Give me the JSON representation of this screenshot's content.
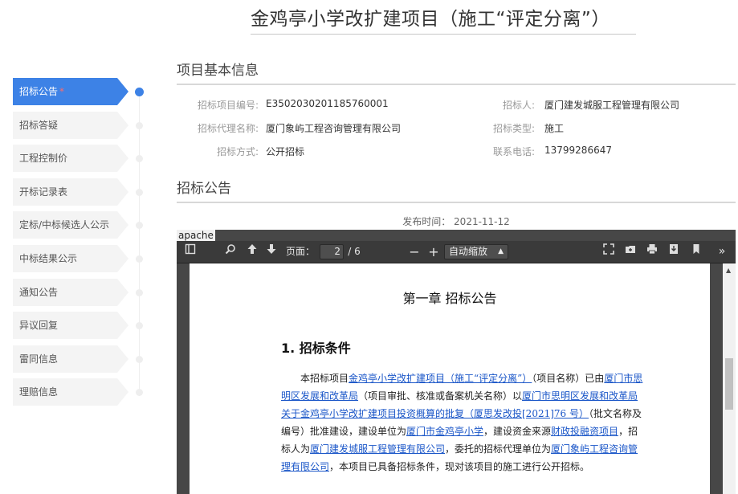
{
  "page": {
    "title": "金鸡亭小学改扩建项目（施工“评定分离”）"
  },
  "sidebar": {
    "items": [
      {
        "label": "招标公告",
        "active": true,
        "marker": "*"
      },
      {
        "label": "招标答疑"
      },
      {
        "label": "工程控制价"
      },
      {
        "label": "开标记录表"
      },
      {
        "label": "定标/中标候选人公示"
      },
      {
        "label": "中标结果公示"
      },
      {
        "label": "通知公告"
      },
      {
        "label": "异议回复"
      },
      {
        "label": "雷同信息"
      },
      {
        "label": "理赔信息"
      }
    ]
  },
  "info": {
    "section_title": "项目基本信息",
    "project_no_label": "招标项目编号:",
    "project_no": "E3502030201185760001",
    "tenderer_label": "招标人:",
    "tenderer": "厦门建发城服工程管理有限公司",
    "agent_label": "招标代理名称:",
    "agent": "厦门象屿工程咨询管理有限公司",
    "type_label": "招标类型:",
    "type": "施工",
    "method_label": "招标方式:",
    "method": "公开招标",
    "phone_label": "联系电话:",
    "phone": "13799286647"
  },
  "notice": {
    "section_title": "招标公告",
    "publish_label": "发布时间：",
    "publish_date": "2021-11-12"
  },
  "pdf": {
    "frame_label": "apache",
    "page_label": "页面：",
    "current_page": "2",
    "total_pages": "/ 6",
    "zoom_value": "自动缩放",
    "chapter": "第一章    招标公告",
    "heading": "1. 招标条件",
    "para": {
      "t1": "本招标项目",
      "u1": "金鸡亭小学改扩建项目（施工“评定分离”）",
      "t2": "（项目名称）已由",
      "u2": "厦门市思明区发展和改革局",
      "t3": "（项目审批、核准或备案机关名称）以",
      "u3": "厦门市思明区发展和改革局关于金鸡亭小学改扩建项目投资概算的批复（厦思发改投[2021]76 号）",
      "t4": "（批文名称及编号）批准建设，建设单位为",
      "u4": "厦门市金鸡亭小学",
      "t5": "，建设资金来源",
      "u5": "财政投融资项目",
      "t6": "，招标人为",
      "u6": "厦门建发城服工程管理有限公司",
      "t7": "，委托的招标代理单位为",
      "u7": "厦门象屿工程咨询管理有限公司",
      "t8": "，本项目已具备招标条件，现对该项目的施工进行公开招标。"
    }
  }
}
